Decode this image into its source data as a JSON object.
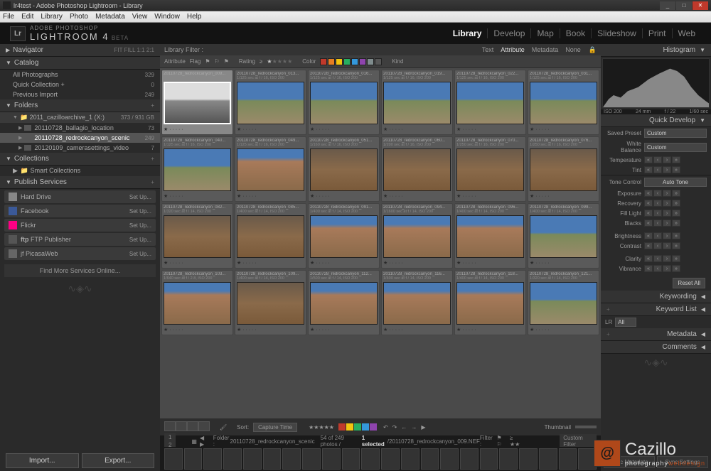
{
  "window": {
    "title": "lr4test - Adobe Photoshop Lightroom - Library"
  },
  "menu": [
    "File",
    "Edit",
    "Library",
    "Photo",
    "Metadata",
    "View",
    "Window",
    "Help"
  ],
  "brand": {
    "top": "ADOBE PHOTOSHOP",
    "main": "LIGHTROOM 4",
    "suffix": "BETA"
  },
  "modules": [
    {
      "label": "Library",
      "active": true
    },
    {
      "label": "Develop"
    },
    {
      "label": "Map"
    },
    {
      "label": "Book"
    },
    {
      "label": "Slideshow"
    },
    {
      "label": "Print"
    },
    {
      "label": "Web"
    }
  ],
  "left": {
    "navigator": {
      "title": "Navigator",
      "opts": "FIT  FILL  1:1  2:1"
    },
    "catalog": {
      "title": "Catalog",
      "items": [
        {
          "label": "All Photographs",
          "count": "329"
        },
        {
          "label": "Quick Collection  +",
          "count": "0"
        },
        {
          "label": "Previous Import",
          "count": "249"
        }
      ]
    },
    "folders": {
      "title": "Folders",
      "root": {
        "label": "2011_cazilloarchive_1 (X:)",
        "count": "373 / 931 GB"
      },
      "items": [
        {
          "label": "20110728_ballagio_location",
          "count": "73"
        },
        {
          "label": "20110728_redrockcanyon_scenic",
          "count": "249",
          "selected": true
        },
        {
          "label": "20120109_camerasettings_video",
          "count": "7"
        }
      ]
    },
    "collections": {
      "title": "Collections",
      "items": [
        {
          "label": "Smart Collections"
        }
      ]
    },
    "publish": {
      "title": "Publish Services",
      "items": [
        {
          "label": "Hard Drive",
          "icon": "#888",
          "action": "Set Up..."
        },
        {
          "label": "Facebook",
          "icon": "#3b5998",
          "action": "Set Up..."
        },
        {
          "label": "Flickr",
          "icon": "#ff0084",
          "action": "Set Up..."
        },
        {
          "label": "FTP Publisher",
          "icon": "#555",
          "prefix": "ftp",
          "action": "Set Up..."
        },
        {
          "label": "jf PicasaWeb",
          "icon": "#666",
          "action": "Set Up..."
        }
      ],
      "more": "Find More Services Online..."
    },
    "import": "Import...",
    "export": "Export..."
  },
  "center": {
    "filter_label": "Library Filter :",
    "filter_tabs": [
      "Text",
      "Attribute",
      "Metadata",
      "None"
    ],
    "filter_active": "Attribute",
    "attrbar": {
      "attribute": "Attribute",
      "flag": "Flag",
      "rating": "Rating",
      "color": "Color",
      "kind": "Kind"
    },
    "swatches": [
      "#c0392b",
      "#e67e22",
      "#f1c40f",
      "#27ae60",
      "#3498db",
      "#8e44ad",
      "#7f8c8d",
      "#555"
    ],
    "thumbs": [
      {
        "name": "20110728_redrockcanyon_009...",
        "meta": "1/60 sec at f / 22, ISO 200",
        "cls": "bw",
        "sel": true
      },
      {
        "name": "20110728_redrockcanyon_013...",
        "meta": "1/125 sec at f / 16, ISO 200",
        "cls": "sky"
      },
      {
        "name": "20110728_redrockcanyon_016...",
        "meta": "1/125 sec at f / 16, ISO 200",
        "cls": "sky"
      },
      {
        "name": "20110728_redrockcanyon_019...",
        "meta": "1/125 sec at f / 16, ISO 200",
        "cls": "sky"
      },
      {
        "name": "20110728_redrockcanyon_022...",
        "meta": "1/125 sec at f / 16, ISO 200",
        "cls": "sky"
      },
      {
        "name": "20110728_redrockcanyon_031...",
        "meta": "1/125 sec at f / 16, ISO 200",
        "cls": "sky"
      },
      {
        "name": "20110728_redrockcanyon_040...",
        "meta": "1/125 sec at f / 16, ISO 200",
        "cls": "sky"
      },
      {
        "name": "20110728_redrockcanyon_049...",
        "meta": "1/125 sec at f / 16, ISO 200",
        "cls": "rock"
      },
      {
        "name": "20110728_redrockcanyon_051...",
        "meta": "1/160 sec at f / 16, ISO 200",
        "cls": "rocky"
      },
      {
        "name": "20110728_redrockcanyon_060...",
        "meta": "1/200 sec at f / 16, ISO 200",
        "cls": "rocky"
      },
      {
        "name": "20110728_redrockcanyon_070...",
        "meta": "1/250 sec at f / 16, ISO 200",
        "cls": "rocky"
      },
      {
        "name": "20110728_redrockcanyon_076...",
        "meta": "1/250 sec at f / 16, ISO 200",
        "cls": "rocky"
      },
      {
        "name": "20110728_redrockcanyon_082...",
        "meta": "1/320 sec at f / 14, ISO 200",
        "cls": "rocky"
      },
      {
        "name": "20110728_redrockcanyon_085...",
        "meta": "1/400 sec at f / 14, ISO 200",
        "cls": "rocky"
      },
      {
        "name": "20110728_redrockcanyon_091...",
        "meta": "1/400 sec at f / 14, ISO 200",
        "cls": "rock"
      },
      {
        "name": "20110728_redrockcanyon_094...",
        "meta": "1/1600 sec at f / 14, ISO 200",
        "cls": "rock"
      },
      {
        "name": "20110728_redrockcanyon_096...",
        "meta": "1/400 sec at f / 14, ISO 200",
        "cls": "rock"
      },
      {
        "name": "20110728_redrockcanyon_099...",
        "meta": "1/400 sec at f / 14, ISO 200",
        "cls": "sky"
      },
      {
        "name": "20110728_redrockcanyon_103...",
        "meta": "1/640 sec at f / 2.8, ISO 200",
        "cls": "rock"
      },
      {
        "name": "20110728_redrockcanyon_109...",
        "meta": "1/400 sec at f / 14, ISO 200",
        "cls": "rocky"
      },
      {
        "name": "20110728_redrockcanyon_112...",
        "meta": "1/500 sec at f / 14, ISO 200",
        "cls": "rock"
      },
      {
        "name": "20110728_redrockcanyon_116...",
        "meta": "1/400 sec at f / 14, ISO 200",
        "cls": "rock"
      },
      {
        "name": "20110728_redrockcanyon_118...",
        "meta": "1/400 sec at f / 14, ISO 200",
        "cls": "rock"
      },
      {
        "name": "20110728_redrockcanyon_121...",
        "meta": "1/320 sec at f / 14, ISO 200",
        "cls": "sky"
      }
    ],
    "sort_label": "Sort:",
    "sort_value": "Capture Time",
    "thumb_label": "Thumbnail",
    "toolbar_swatches": [
      "#c0392b",
      "#f1c40f",
      "#27ae60",
      "#3498db",
      "#8e44ad"
    ]
  },
  "filmstrip": {
    "folder_label": "Folder :",
    "folder": "20110728_redrockcanyon_scenic",
    "count": "54 of 249 photos /",
    "selected": "1 selected",
    "file": "/20110728_redrockcanyon_009.NEF",
    "filter_label": "Filter :",
    "custom": "Custom Filter"
  },
  "right": {
    "histogram_title": "Histogram",
    "hist_labels": [
      "ISO 200",
      "24 mm",
      "f / 22",
      "1/60 sec"
    ],
    "qd": {
      "title": "Quick Develop",
      "preset_label": "Saved Preset",
      "preset": "Custom",
      "wb_label": "White Balance",
      "wb": "Custom",
      "sliders": [
        "Temperature",
        "Tint"
      ],
      "tone": "Tone Control",
      "auto": "Auto Tone",
      "tone_sliders": [
        "Exposure",
        "Recovery",
        "Fill Light",
        "Blacks"
      ],
      "extra": [
        "Brightness",
        "Contrast"
      ],
      "clarity": [
        "Clarity",
        "Vibrance"
      ],
      "reset": "Reset All"
    },
    "sections": [
      "Keywording",
      "Keyword List",
      "Metadata",
      "Comments"
    ],
    "lr_label": "LR",
    "lr_val": "All",
    "sync_meta": "Sync Metadata",
    "sync_set": "Sync Settings"
  },
  "watermark": {
    "name": "Cazillo",
    "tag1": "photography",
    "tag2": "webdesign"
  }
}
